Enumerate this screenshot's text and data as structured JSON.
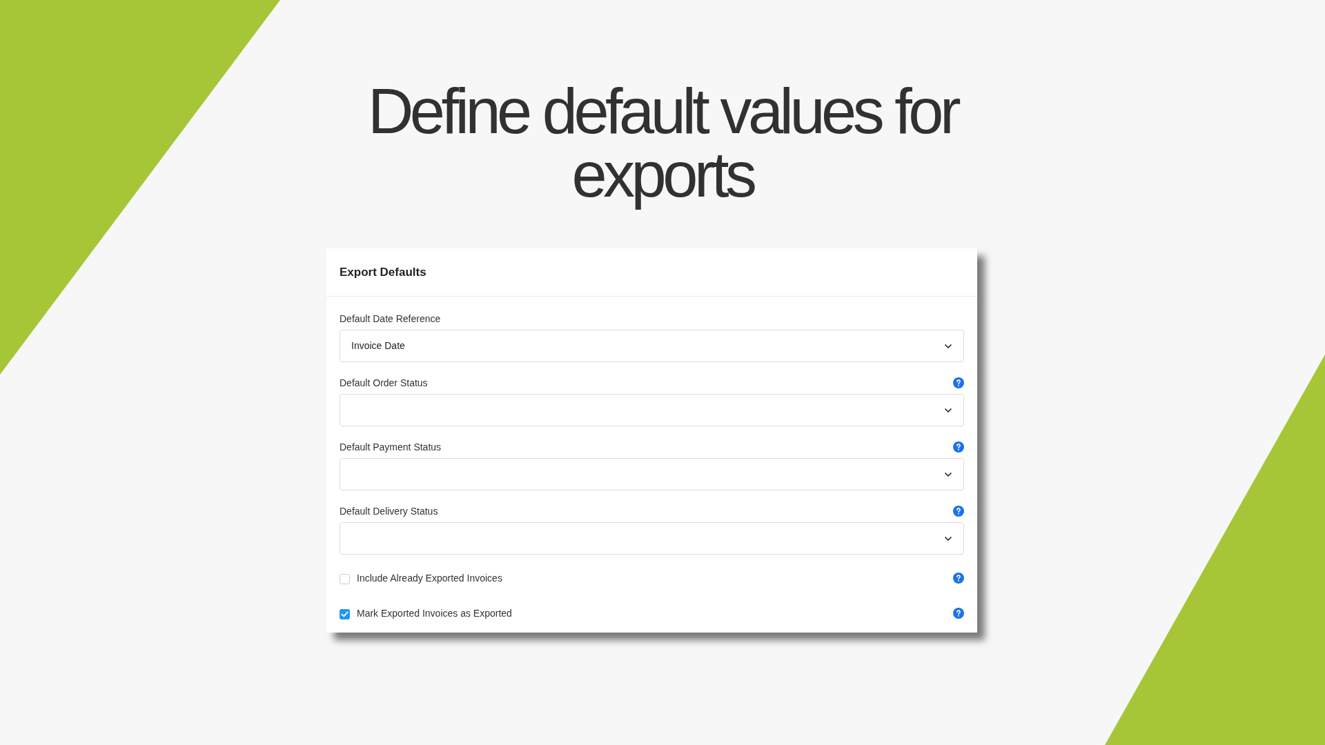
{
  "title": "Define default values for exports",
  "card": {
    "title": "Export Defaults",
    "fields": [
      {
        "label": "Default Date Reference",
        "value": "Invoice Date",
        "help": false
      },
      {
        "label": "Default Order Status",
        "help": true
      },
      {
        "label": "Default Payment Status",
        "help": true
      },
      {
        "label": "Default Delivery Status",
        "help": true
      }
    ],
    "checkboxes": [
      {
        "label": "Include Already Exported Invoices",
        "checked": false,
        "help": true
      },
      {
        "label": "Mark Exported Invoices as Exported",
        "checked": true,
        "help": true
      }
    ]
  }
}
